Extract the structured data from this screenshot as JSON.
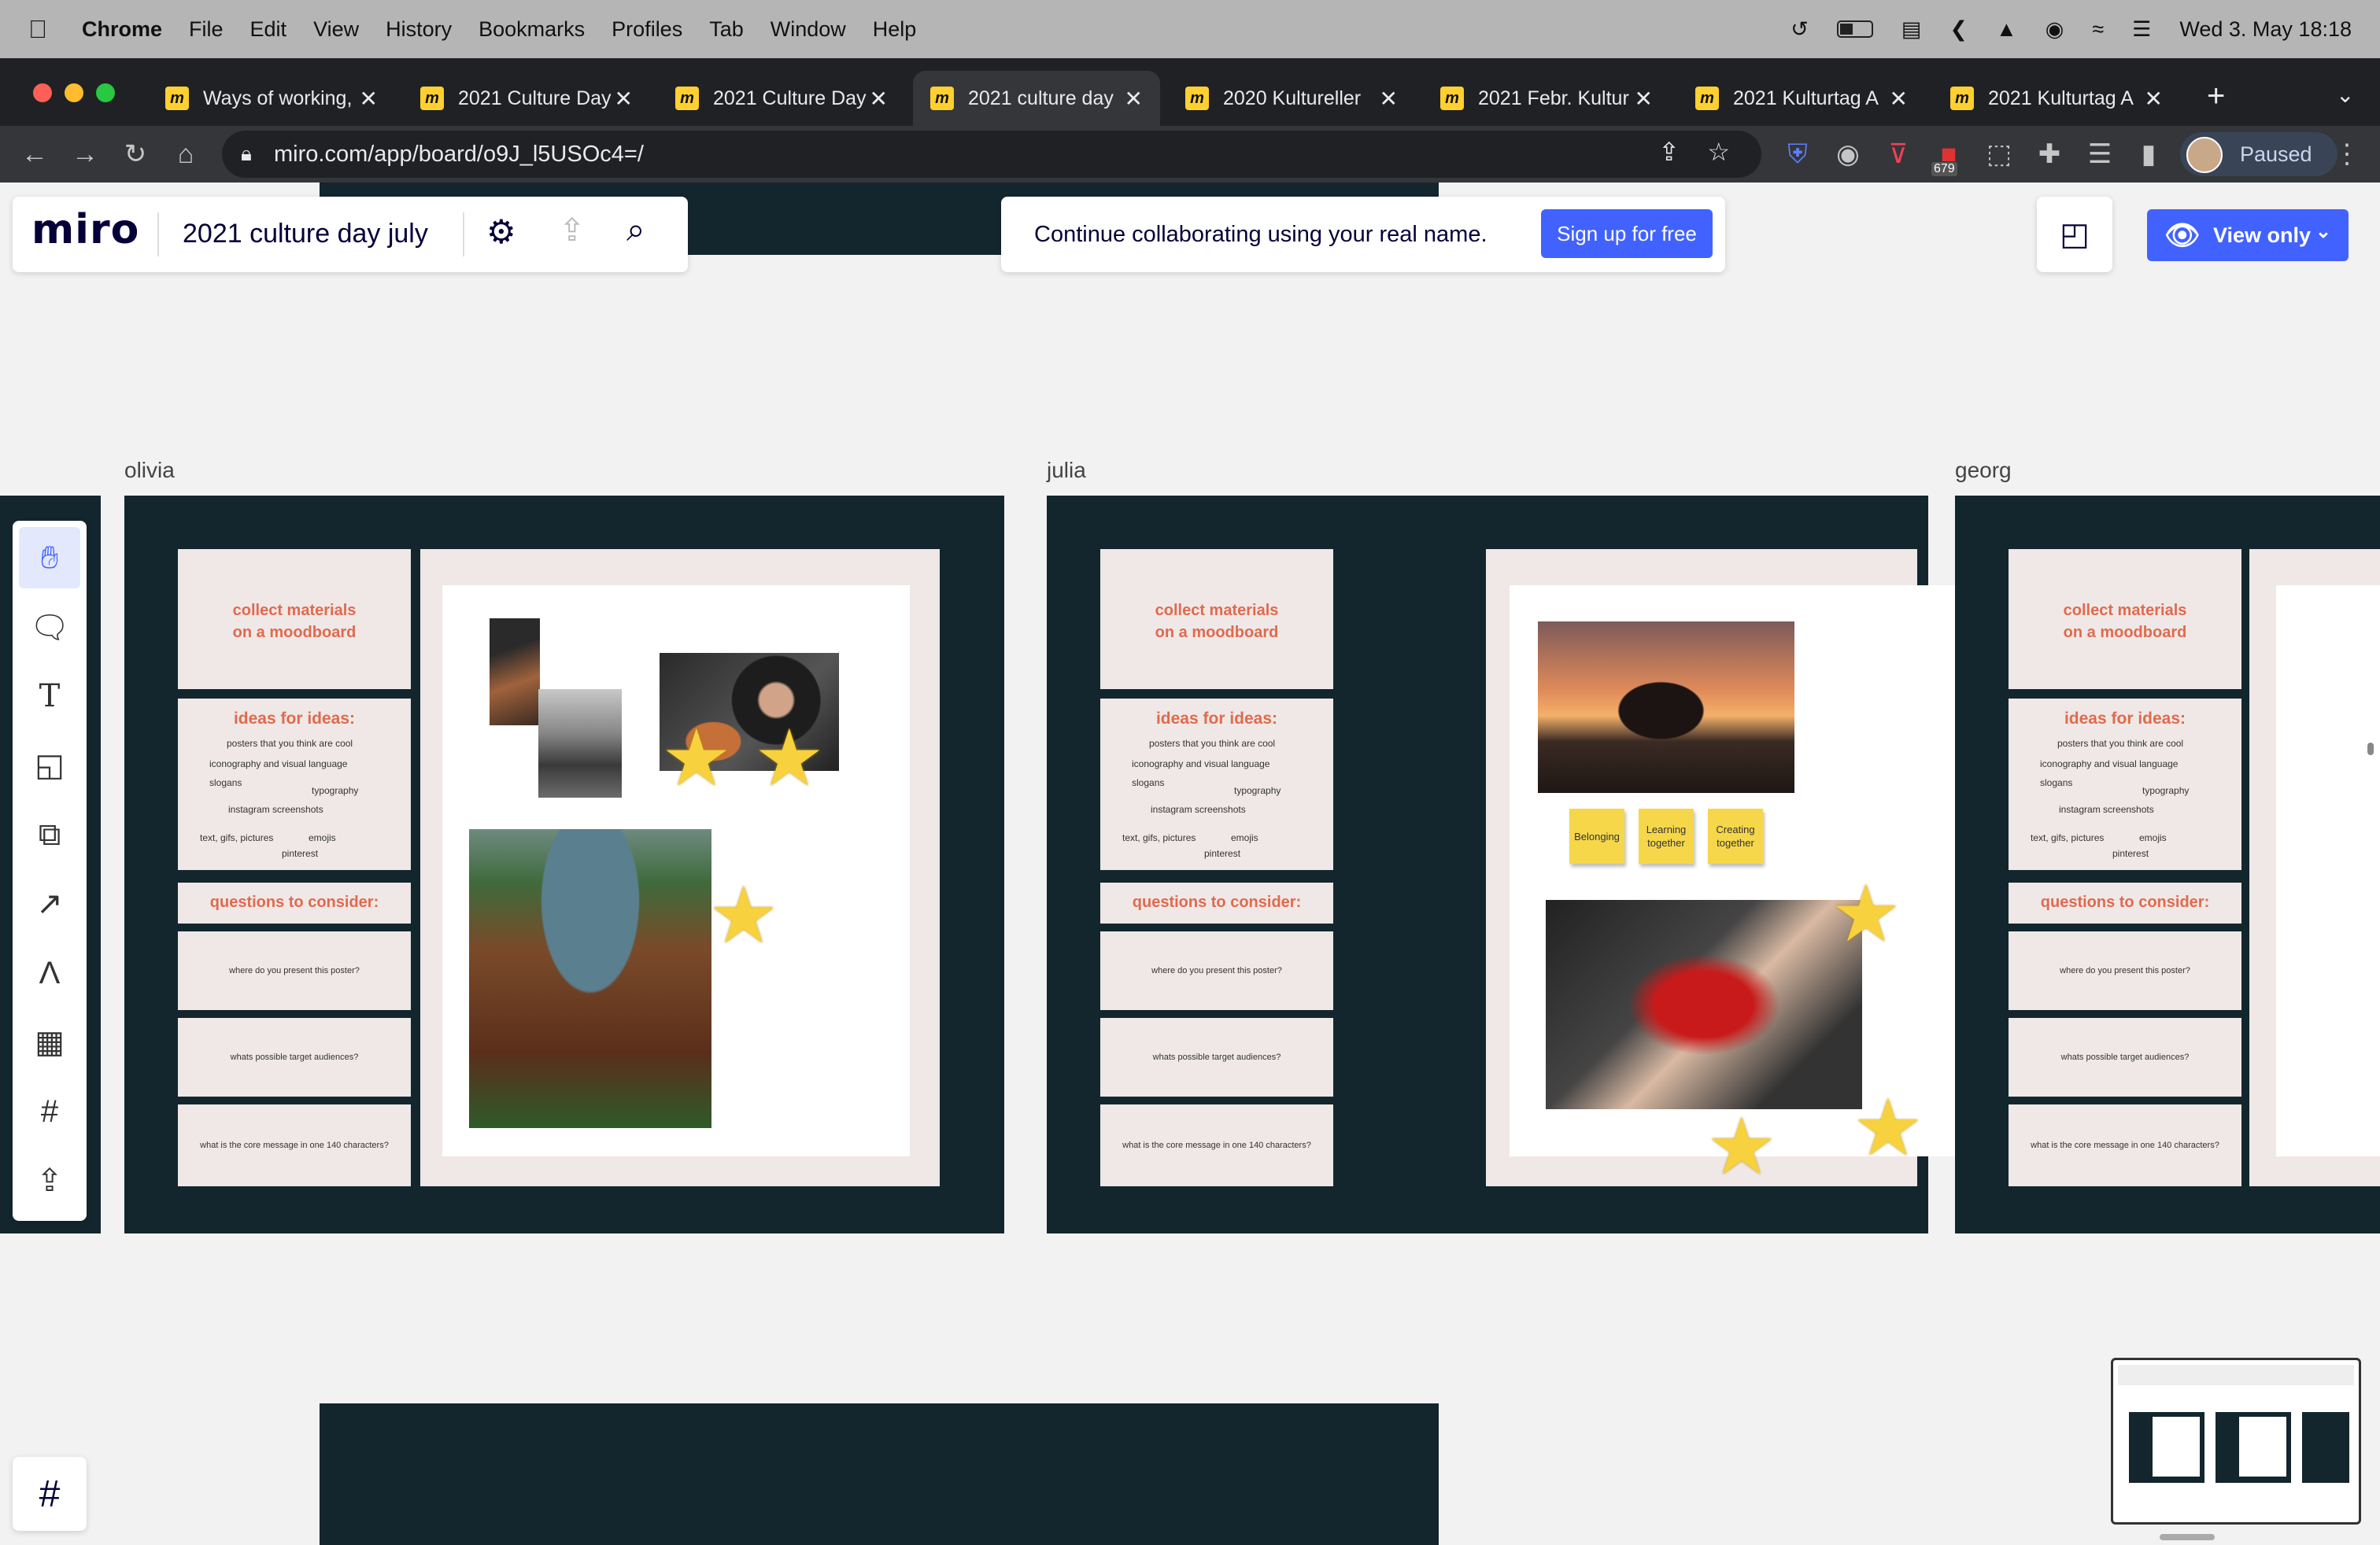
{
  "menubar": {
    "app": "Chrome",
    "items": [
      "File",
      "Edit",
      "View",
      "History",
      "Bookmarks",
      "Profiles",
      "Tab",
      "Window",
      "Help"
    ],
    "clock": "Wed 3. May  18:18"
  },
  "tabs": [
    {
      "title": "Ways of working,"
    },
    {
      "title": "2021 Culture Day"
    },
    {
      "title": "2021 Culture Day"
    },
    {
      "title": "2021 culture day"
    },
    {
      "title": "2020 Kultureller"
    },
    {
      "title": "2021 Febr. Kultur"
    },
    {
      "title": "2021 Kulturtag A"
    },
    {
      "title": "2021 Kulturtag A"
    }
  ],
  "browser": {
    "url": "miro.com/app/board/o9J_l5USOc4=/",
    "profile_label": "Paused",
    "badge_count": "679"
  },
  "miro": {
    "logo": "miro",
    "board_title": "2021 culture day july",
    "banner_text": "Continue collaborating using your real name.",
    "signup_label": "Sign up for free",
    "view_only_label": "View only"
  },
  "frames": [
    {
      "name": "olivia"
    },
    {
      "name": "julia"
    },
    {
      "name": "georg"
    }
  ],
  "template": {
    "collect_line1": "collect materials",
    "collect_line2": "on a moodboard",
    "ideas_title": "ideas for ideas:",
    "idea_posters": "posters that you think are cool",
    "idea_iconography": "iconography and visual language",
    "idea_slogans": "slogans",
    "idea_typography": "typography",
    "idea_instagram": "instagram screenshots",
    "idea_gifs": "text, gifs, pictures",
    "idea_emojis": "emojis",
    "idea_pinterest": "pinterest",
    "questions_title": "questions to consider:",
    "q1": "where do you present this poster?",
    "q2": "whats possible target audiences?",
    "q3": "what is the core message in one 140 characters?"
  },
  "stickies": [
    "Belonging",
    "Learning together",
    "Creating together"
  ],
  "colors": {
    "accent": "#4262ff",
    "frame_dark": "#13262e",
    "card_bg": "#efe8e6",
    "heading": "#e06a4e",
    "sticky": "#f6d74a"
  }
}
